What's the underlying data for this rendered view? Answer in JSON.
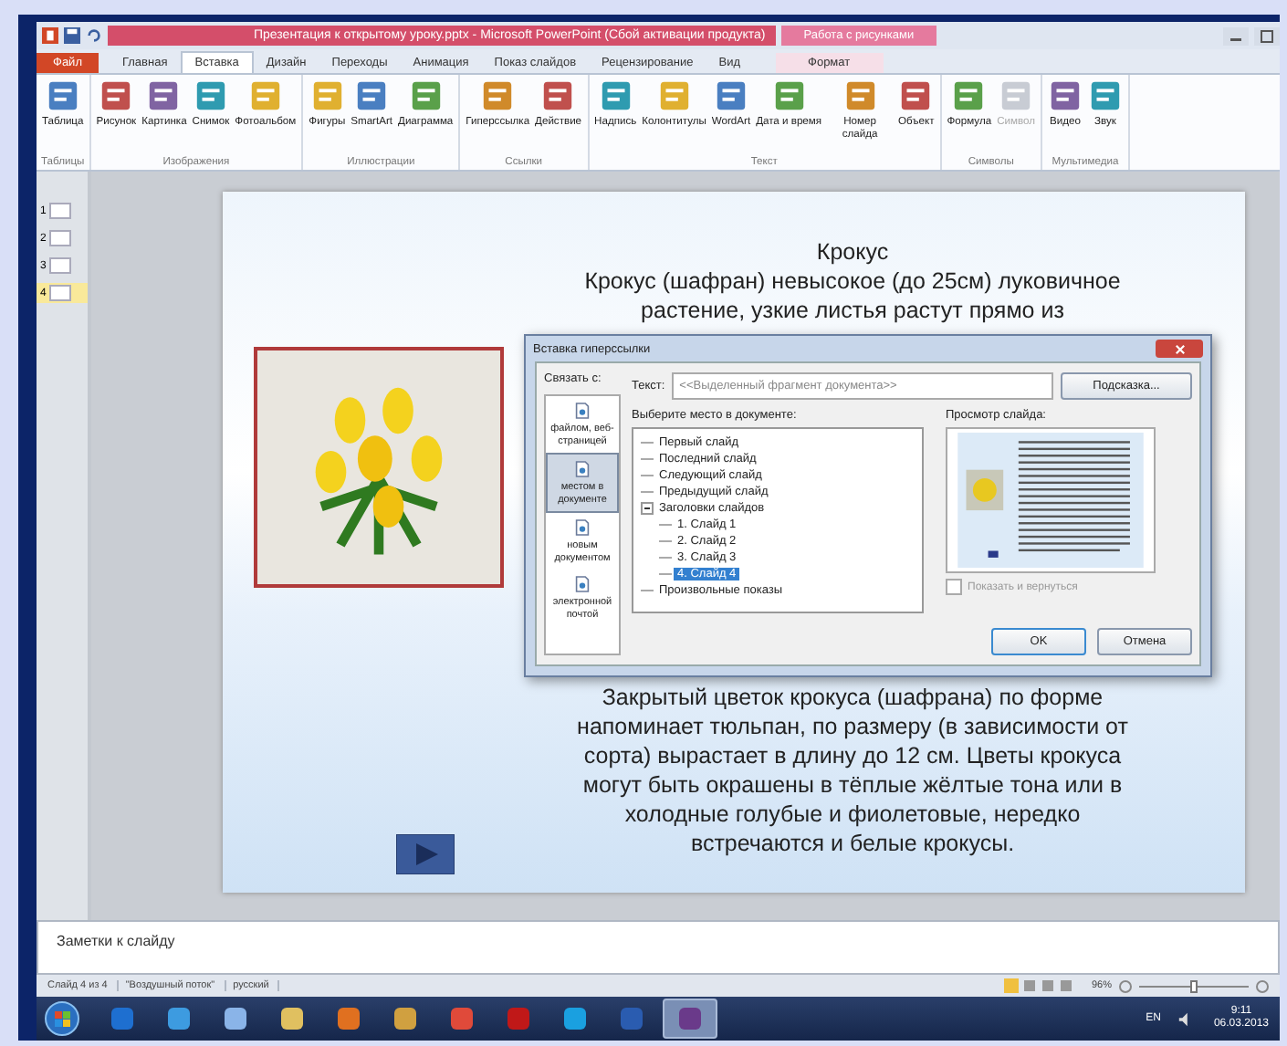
{
  "window": {
    "title": "Презентация к открытому уроку.pptx - Microsoft PowerPoint (Сбой активации продукта)",
    "context_tab": "Работа с рисунками"
  },
  "tabs": [
    {
      "label": "Файл",
      "selected": false,
      "kind": "file"
    },
    {
      "label": "Главная",
      "selected": false,
      "kind": "tab"
    },
    {
      "label": "Вставка",
      "selected": true,
      "kind": "tab"
    },
    {
      "label": "Дизайн",
      "selected": false,
      "kind": "tab"
    },
    {
      "label": "Переходы",
      "selected": false,
      "kind": "tab"
    },
    {
      "label": "Анимация",
      "selected": false,
      "kind": "tab"
    },
    {
      "label": "Показ слайдов",
      "selected": false,
      "kind": "tab"
    },
    {
      "label": "Рецензирование",
      "selected": false,
      "kind": "tab"
    },
    {
      "label": "Вид",
      "selected": false,
      "kind": "tab"
    },
    {
      "label": "Формат",
      "selected": false,
      "kind": "context"
    }
  ],
  "ribbon": {
    "groups": [
      {
        "name": "Таблицы",
        "buttons": [
          {
            "label": "Таблица",
            "disabled": false
          }
        ]
      },
      {
        "name": "Изображения",
        "buttons": [
          {
            "label": "Рисунок",
            "disabled": false
          },
          {
            "label": "Картинка",
            "disabled": false
          },
          {
            "label": "Снимок",
            "disabled": false
          },
          {
            "label": "Фотоальбом",
            "disabled": false
          }
        ]
      },
      {
        "name": "Иллюстрации",
        "buttons": [
          {
            "label": "Фигуры",
            "disabled": false
          },
          {
            "label": "SmartArt",
            "disabled": false
          },
          {
            "label": "Диаграмма",
            "disabled": false
          }
        ]
      },
      {
        "name": "Ссылки",
        "buttons": [
          {
            "label": "Гиперссылка",
            "disabled": false
          },
          {
            "label": "Действие",
            "disabled": false
          }
        ]
      },
      {
        "name": "Текст",
        "buttons": [
          {
            "label": "Надпись",
            "disabled": false
          },
          {
            "label": "Колонтитулы",
            "disabled": false
          },
          {
            "label": "WordArt",
            "disabled": false
          },
          {
            "label": "Дата и время",
            "disabled": false
          },
          {
            "label": "Номер слайда",
            "disabled": false
          },
          {
            "label": "Объект",
            "disabled": false
          }
        ]
      },
      {
        "name": "Символы",
        "buttons": [
          {
            "label": "Формула",
            "disabled": false
          },
          {
            "label": "Символ",
            "disabled": true
          }
        ]
      },
      {
        "name": "Мультимедиа",
        "buttons": [
          {
            "label": "Видео",
            "disabled": false
          },
          {
            "label": "Звук",
            "disabled": false
          }
        ]
      }
    ]
  },
  "slides_panel": {
    "items": [
      {
        "number": "1",
        "selected": false
      },
      {
        "number": "2",
        "selected": false
      },
      {
        "number": "3",
        "selected": false
      },
      {
        "number": "4",
        "selected": true
      }
    ]
  },
  "slide": {
    "title": "Крокус",
    "lines_top": [
      "Крокус (шафран) невысокое (до 25см) луковичное",
      "растение, узкие листья растут прямо из"
    ],
    "lines_bottom": [
      "Закрытый цветок крокуса (шафрана) по форме",
      "напоминает тюльпан, по размеру (в зависимости от",
      "сорта) вырастает в длину до 12 см. Цветы крокуса",
      "могут быть окрашены в тёплые жёлтые тона или в",
      "холодные голубые и фиолетовые, нередко",
      "встречаются и белые крокусы."
    ]
  },
  "dialog": {
    "title": "Вставка гиперссылки",
    "link_to_label": "Связать с:",
    "text_label": "Текст:",
    "text_value": "<<Выделенный фрагмент документа>>",
    "hint_button": "Подсказка...",
    "link_targets": [
      {
        "label": "файлом, веб-страницей",
        "selected": false
      },
      {
        "label": "местом в документе",
        "selected": true
      },
      {
        "label": "новым документом",
        "selected": false
      },
      {
        "label": "электронной почтой",
        "selected": false
      }
    ],
    "place_label": "Выберите место в документе:",
    "tree": [
      {
        "label": "Первый слайд",
        "selected": false
      },
      {
        "label": "Последний слайд",
        "selected": false
      },
      {
        "label": "Следующий слайд",
        "selected": false
      },
      {
        "label": "Предыдущий слайд",
        "selected": false
      },
      {
        "label": "Заголовки слайдов",
        "selected": false,
        "expanded": true,
        "children": [
          {
            "label": "1. Слайд 1",
            "selected": false
          },
          {
            "label": "2. Слайд 2",
            "selected": false
          },
          {
            "label": "3. Слайд 3",
            "selected": false
          },
          {
            "label": "4. Слайд 4",
            "selected": true
          }
        ]
      },
      {
        "label": "Произвольные показы",
        "selected": false
      }
    ],
    "preview_label": "Просмотр слайда:",
    "show_and_return": {
      "label": "Показать и вернуться",
      "checked": false,
      "disabled": true
    },
    "buttons": [
      "OK",
      "Отмена"
    ]
  },
  "notes": {
    "placeholder": "Заметки к слайду"
  },
  "status_bar": {
    "items": [
      "Слайд 4 из 4",
      "\"Воздушный поток\"",
      "русский"
    ],
    "zoom": "96%",
    "zoom_slider": {
      "level": 0.5
    }
  },
  "taskbar": {
    "apps": [
      {
        "selected": false
      },
      {
        "selected": false
      },
      {
        "selected": false
      },
      {
        "selected": false
      },
      {
        "selected": false
      },
      {
        "selected": false
      },
      {
        "selected": false
      },
      {
        "selected": false
      },
      {
        "selected": false
      },
      {
        "selected": false
      },
      {
        "selected": true
      }
    ],
    "language": "EN",
    "time": "9:11",
    "date": "06.03.2013"
  }
}
